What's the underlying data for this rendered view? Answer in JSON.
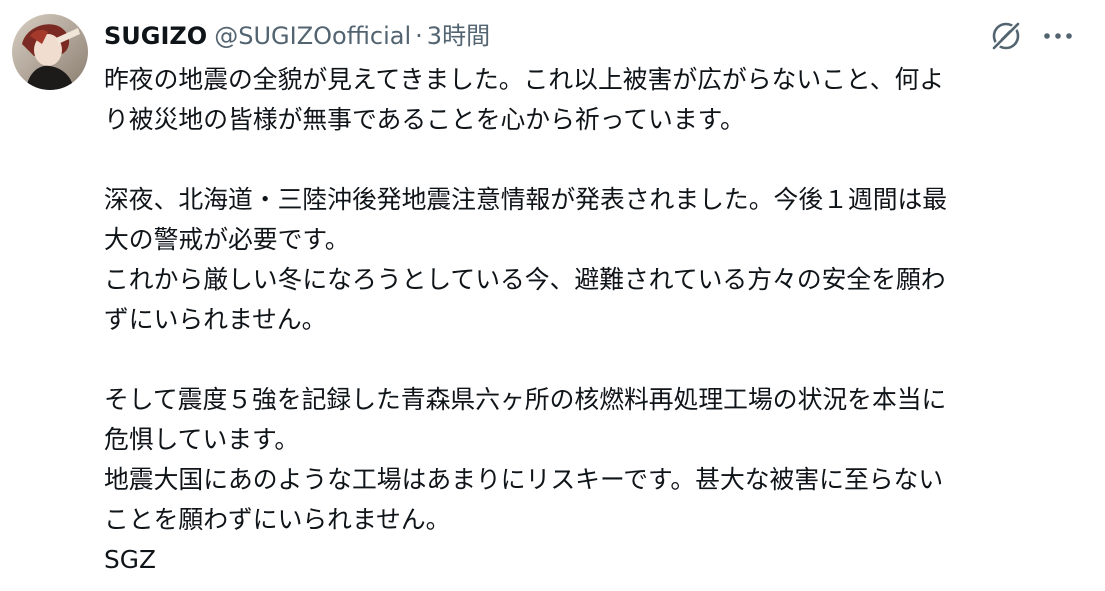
{
  "author": {
    "display_name": "SUGIZO",
    "handle": "@SUGIZOofficial",
    "separator": "·",
    "timestamp": "3時間"
  },
  "icons": {
    "avatar": "user-avatar",
    "grok": "grok-icon",
    "more": "more-dots-icon"
  },
  "colors": {
    "text": "#0f1419",
    "secondary": "#536471"
  },
  "body": {
    "lines": [
      "昨夜の地震の全貌が見えてきました。これ以上被害が広がらないこと、何よ",
      "り被災地の皆様が無事であることを心から祈っています。",
      "",
      "深夜、北海道・三陸沖後発地震注意情報が発表されました。今後１週間は最",
      "大の警戒が必要です。",
      "これから厳しい冬になろうとしている今、避難されている方々の安全を願わ",
      "ずにいられません。",
      "",
      "そして震度５強を記録した青森県六ヶ所の核燃料再処理工場の状況を本当に",
      "危惧しています。",
      "地震大国にあのような工場はあまりにリスキーです。甚大な被害に至らない",
      "ことを願わずにいられません。",
      "SGZ"
    ]
  }
}
